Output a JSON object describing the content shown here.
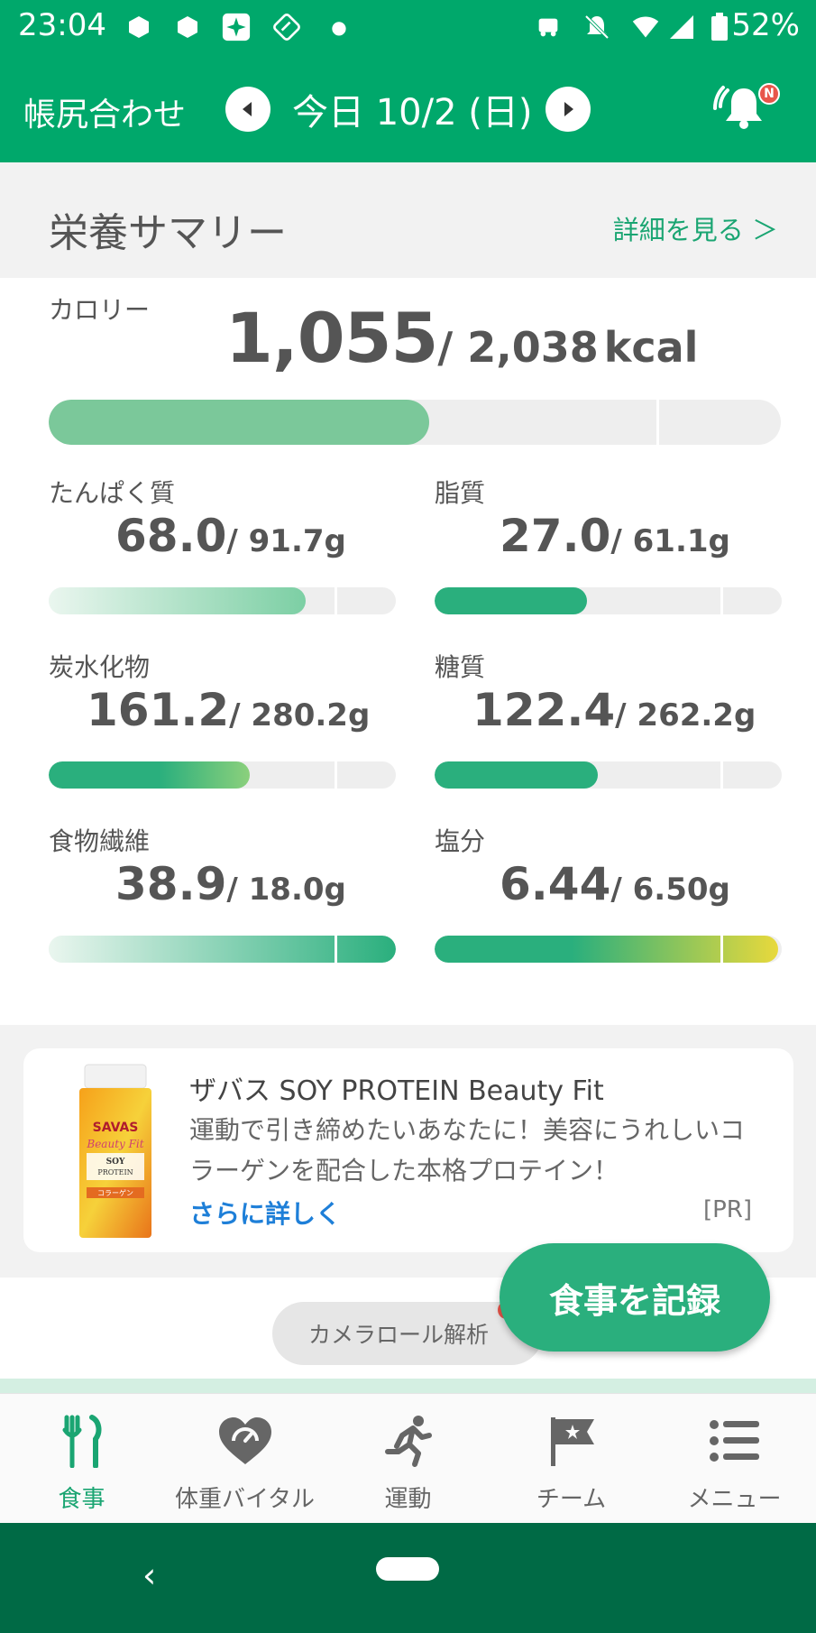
{
  "status_bar": {
    "time": "23:04",
    "battery": "52%"
  },
  "app_bar": {
    "title": "帳尻合わせ",
    "date": "今日 10/2 (日)",
    "notification_badge": "N"
  },
  "summary": {
    "title": "栄養サマリー",
    "details_link": "詳細を見る ＞"
  },
  "calorie": {
    "label": "カロリー",
    "value": "1,055",
    "target": "/ 2,038",
    "unit": "kcal",
    "progress": 0.52
  },
  "nutrients": [
    {
      "label": "たんぱく質",
      "value": "68.0",
      "target": "/ 91.7g",
      "progress": 0.74
    },
    {
      "label": "脂質",
      "value": "27.0",
      "target": "/ 61.1g",
      "progress": 0.44
    },
    {
      "label": "炭水化物",
      "value": "161.2",
      "target": "/ 280.2g",
      "progress": 0.58
    },
    {
      "label": "糖質",
      "value": "122.4",
      "target": "/ 262.2g",
      "progress": 0.47
    },
    {
      "label": "食物繊維",
      "value": "38.9",
      "target": "/ 18.0g",
      "progress": 1.0
    },
    {
      "label": "塩分",
      "value": "6.44",
      "target": "/ 6.50g",
      "progress": 0.99
    }
  ],
  "ad": {
    "title": "ザバス SOY PROTEIN Beauty Fit",
    "body": "運動で引き締めたいあなたに！美容にうれしいコラーゲンを配合した本格プロテイン！",
    "link": "さらに詳しく",
    "tag": "[PR]",
    "product_brand": "SAVAS",
    "product_sub": "Beauty Fit",
    "product_line": "SOY PROTEIN",
    "product_flavor": "コラーゲン"
  },
  "camera_button": "カメラロール解析",
  "fab": "食事を記録",
  "tabs": [
    {
      "label": "食事",
      "icon": "fork-knife-icon",
      "active": true
    },
    {
      "label": "体重バイタル",
      "icon": "heart-scale-icon",
      "active": false
    },
    {
      "label": "運動",
      "icon": "runner-icon",
      "active": false
    },
    {
      "label": "チーム",
      "icon": "flag-star-icon",
      "active": false
    },
    {
      "label": "メニュー",
      "icon": "list-icon",
      "active": false
    }
  ],
  "colors": {
    "primary": "#00a86b",
    "nav_dark": "#006a45",
    "link_green": "#1aa572",
    "link_blue": "#1e7fd8"
  }
}
